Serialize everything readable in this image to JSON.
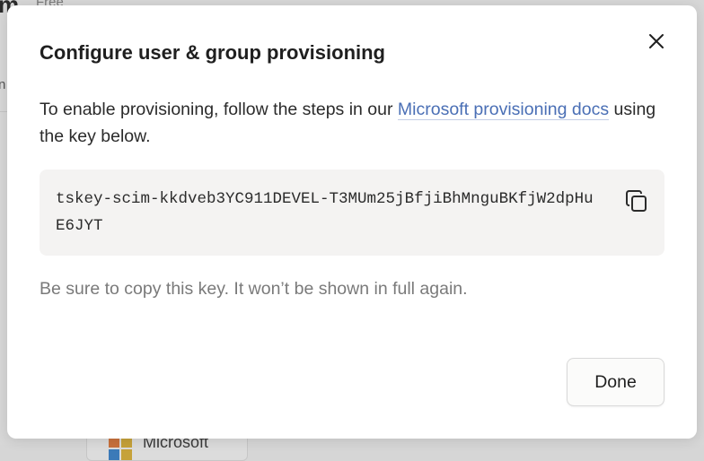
{
  "background": {
    "heading_fragment": "m",
    "plan_fragment": "Free",
    "left_fragment": "n",
    "card_label": "Microsoft"
  },
  "dialog": {
    "title": "Configure user & group provisioning",
    "description_before_link": "To enable provisioning, follow the steps in our ",
    "link_text": "Microsoft provisioning docs",
    "description_after_link": " using the key below.",
    "key_value": "tskey-scim-kkdveb3YC911DEVEL-T3MUm25jBfjiBhMnguBKfjW2dpHuE6JYT",
    "note": "Be sure to copy this key. It won’t be shown in full again.",
    "done_label": "Done"
  },
  "icons": {
    "close": "close-icon",
    "copy": "copy-icon",
    "microsoft": "microsoft-logo-icon"
  },
  "colors": {
    "link": "#4a6fb5",
    "overlay": "#d7d7d7",
    "key_background": "#f4f3f2"
  }
}
